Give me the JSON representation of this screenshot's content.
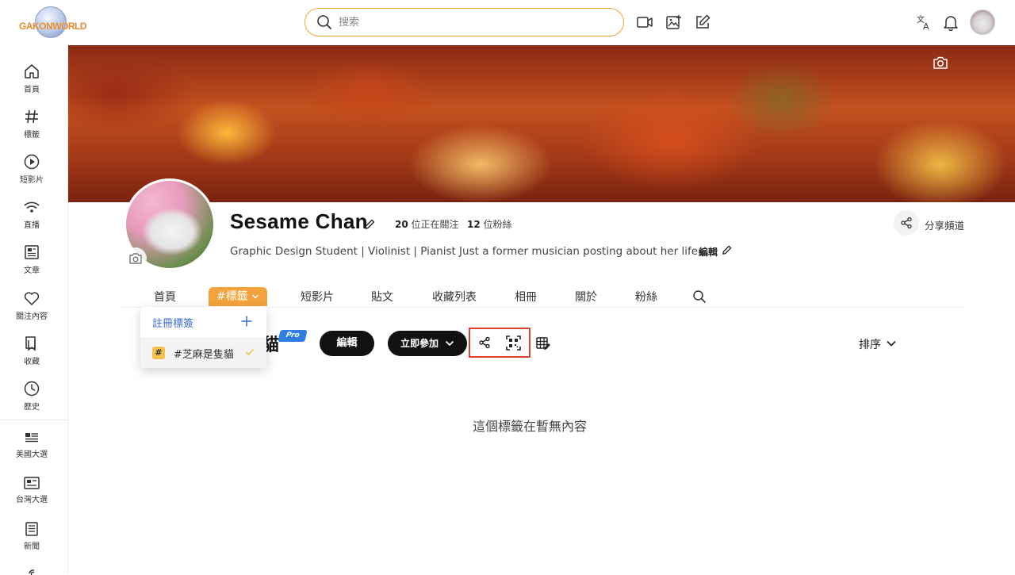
{
  "header": {
    "logo_text": "GAKONWORLD",
    "search": {
      "placeholder": "搜索",
      "value": ""
    },
    "icons": [
      "video-icon",
      "image-add-icon",
      "edit-icon",
      "translate-icon",
      "bell-icon"
    ]
  },
  "sidebar": {
    "items": [
      {
        "label": "首頁",
        "icon": "home-icon"
      },
      {
        "label": "標籤",
        "icon": "hashtag-icon"
      },
      {
        "label": "短影片",
        "icon": "play-icon"
      },
      {
        "label": "直播",
        "icon": "wifi-icon"
      },
      {
        "label": "文章",
        "icon": "article-icon"
      },
      {
        "label": "關注內容",
        "icon": "heart-icon"
      },
      {
        "label": "收藏",
        "icon": "bookmark-icon"
      },
      {
        "label": "歷史",
        "icon": "clock-icon"
      },
      {
        "label": "美國大選",
        "icon": "news-icon"
      },
      {
        "label": "台灣大選",
        "icon": "id-card-icon"
      },
      {
        "label": "新聞",
        "icon": "newspaper-icon"
      }
    ]
  },
  "profile": {
    "name": "Sesame Chan",
    "following_count": "20",
    "following_label": "位正在關注",
    "followers_count": "12",
    "followers_label": "位粉絲",
    "bio": "Graphic Design Student | Violinist | Pianist Just a former musician posting about her life~",
    "bio_edit_label": "編輯",
    "share_channel_label": "分享頻道"
  },
  "tabs": {
    "items": [
      "首頁",
      "#標籤",
      "短影片",
      "貼文",
      "收藏列表",
      "相冊",
      "關於",
      "粉絲"
    ],
    "active": "#標籤"
  },
  "dropdown": {
    "register_label": "註冊標簽",
    "tag_label": "#芝麻是隻貓",
    "tag_hash": "#"
  },
  "actions": {
    "title_tail": "貓",
    "pro_badge": "Pro",
    "edit_label": "編輯",
    "join_label": "立即參加",
    "sort_label": "排序"
  },
  "content": {
    "empty_message": "這個標籤在暫無內容"
  },
  "colors": {
    "accent": "#f3a23d",
    "link": "#3b6cd6",
    "highlight": "#d9432f",
    "dark_button": "#111111"
  }
}
